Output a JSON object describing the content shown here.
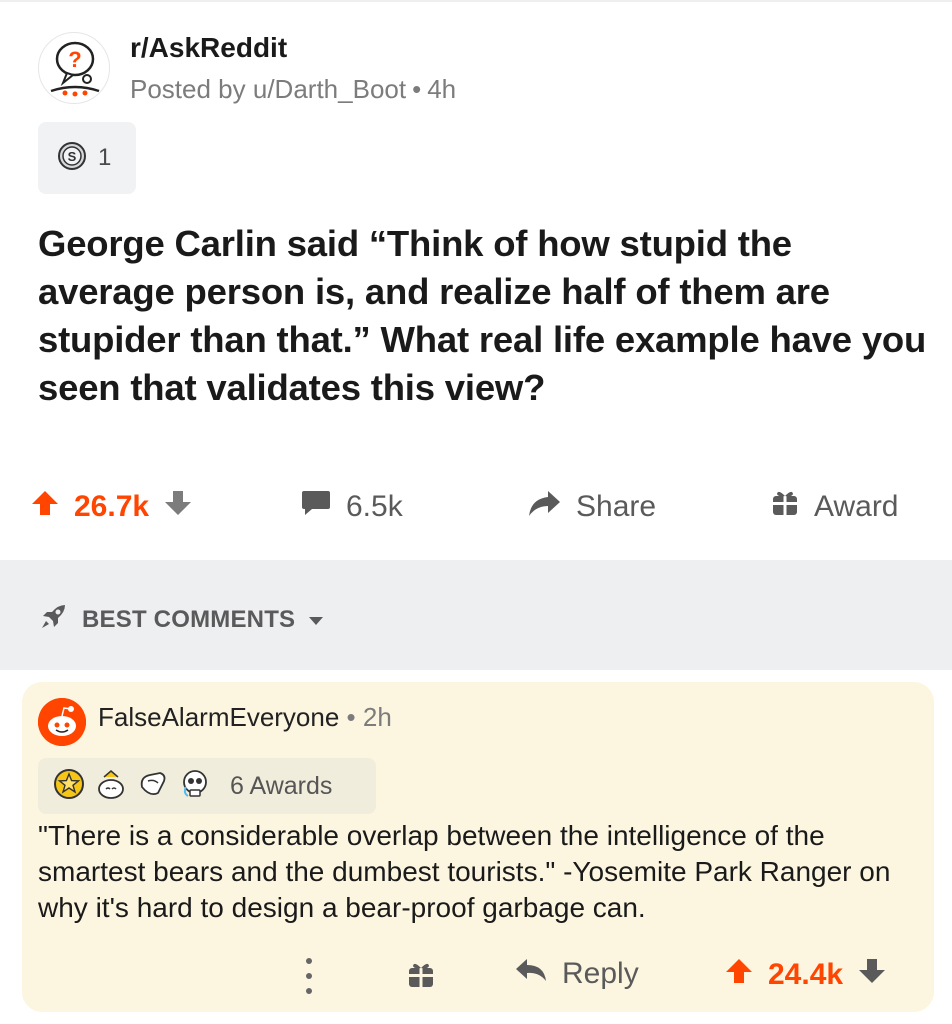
{
  "post": {
    "subreddit": "r/AskReddit",
    "posted_by_prefix": "Posted by",
    "author": "u/Darth_Boot",
    "separator": "•",
    "age": "4h",
    "award_count": "1",
    "title": "George Carlin said “Think of how stupid the average person is, and realize half of them are stupider than that.” What real life example have you seen that validates this view?",
    "score": "26.7k",
    "comment_count": "6.5k",
    "share_label": "Share",
    "award_label": "Award"
  },
  "sort": {
    "label": "BEST COMMENTS"
  },
  "comment": {
    "author": "FalseAlarmEveryone",
    "separator": "•",
    "age": "2h",
    "awards_label": "6 Awards",
    "body": "\"There is a considerable overlap between the intelligence of the smartest bears and the dumbest tourists.\"  -Yosemite Park Ranger on why it's hard to design a bear-proof garbage can.",
    "reply_label": "Reply",
    "score": "24.4k"
  },
  "colors": {
    "upvote": "#ff4500",
    "sort_bar": "#edeff1",
    "comment_bg": "#fcf6e0"
  },
  "icons": [
    "askreddit-avatar",
    "silver-award-icon",
    "upvote-icon",
    "downvote-icon",
    "comment-icon",
    "share-icon",
    "gift-icon",
    "rocket-icon",
    "chevron-down-icon",
    "snoo-avatar",
    "gold-star-award-icon",
    "wholesome-award-icon",
    "hugz-award-icon",
    "skull-award-icon",
    "more-dots-icon",
    "reply-icon"
  ]
}
